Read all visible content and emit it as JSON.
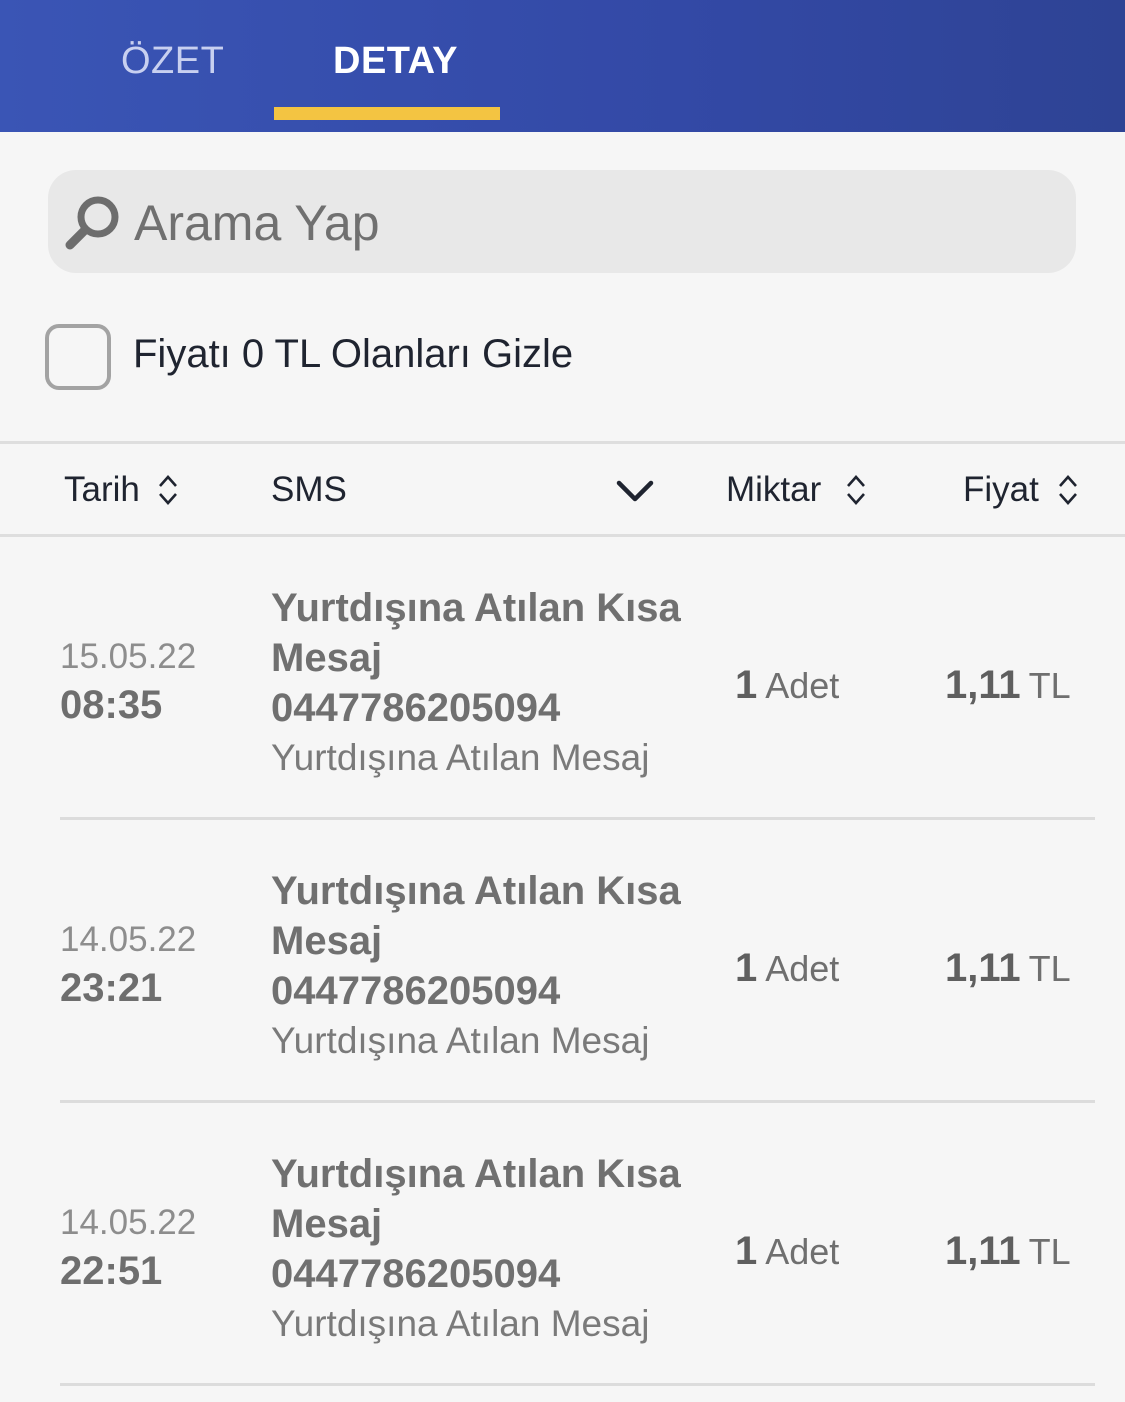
{
  "tabs": {
    "summary_label": "ÖZET",
    "detail_label": "DETAY",
    "active": "DETAY"
  },
  "colors": {
    "header": "#3a55b5",
    "tab_indicator": "#f3c442"
  },
  "search": {
    "placeholder": "Arama Yap",
    "value": ""
  },
  "filter": {
    "hide_zero_label": "Fiyatı 0 TL Olanları Gizle",
    "checked": false
  },
  "table": {
    "columns": {
      "date": "Tarih",
      "type": "SMS",
      "quantity": "Miktar",
      "price": "Fiyat"
    },
    "rows": [
      {
        "date": "15.05.22",
        "time": "08:35",
        "title": "Yurtdışına Atılan Kısa Mesaj",
        "number": "0447786205094",
        "description": "Yurtdışına Atılan Mesaj",
        "qty": "1",
        "qty_unit": "Adet",
        "price": "1,11",
        "currency": "TL"
      },
      {
        "date": "14.05.22",
        "time": "23:21",
        "title": "Yurtdışına Atılan Kısa Mesaj",
        "number": "0447786205094",
        "description": "Yurtdışına Atılan Mesaj",
        "qty": "1",
        "qty_unit": "Adet",
        "price": "1,11",
        "currency": "TL"
      },
      {
        "date": "14.05.22",
        "time": "22:51",
        "title": "Yurtdışına Atılan Kısa Mesaj",
        "number": "0447786205094",
        "description": "Yurtdışına Atılan Mesaj",
        "qty": "1",
        "qty_unit": "Adet",
        "price": "1,11",
        "currency": "TL"
      }
    ]
  }
}
